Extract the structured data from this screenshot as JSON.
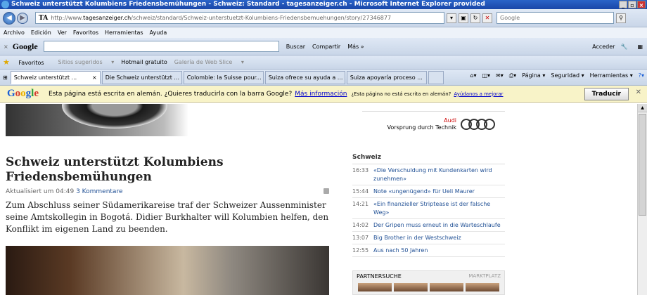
{
  "window": {
    "title": "Schweiz unterstützt Kolumbiens Friedensbemühungen - Schweiz: Standard - tagesanzeiger.ch - Microsoft Internet Explorer provided"
  },
  "address_bar": {
    "url_prefix": "http://www.",
    "url_domain": "tagesanzeiger.ch",
    "url_path": "/schweiz/standard/Schweiz-unterstuetzt-Kolumbiens-Friedensbemuehungen/story/27346877",
    "search_placeholder": "Google"
  },
  "menu": [
    "Archivo",
    "Edición",
    "Ver",
    "Favoritos",
    "Herramientas",
    "Ayuda"
  ],
  "google_toolbar": {
    "logo": "Google",
    "buscar": "Buscar",
    "compartir": "Compartir",
    "mas": "Más »",
    "acceder": "Acceder"
  },
  "favorites_bar": {
    "favoritos": "Favoritos",
    "sitios": "Sitios sugeridos",
    "hotmail": "Hotmail gratuito",
    "galeria": "Galería de Web Slice"
  },
  "tabs": [
    {
      "label": "Schweiz unterstützt ..."
    },
    {
      "label": "Die Schweiz unterstützt ..."
    },
    {
      "label": "Colombie: la Suisse pour..."
    },
    {
      "label": "Suiza ofrece su ayuda a ..."
    },
    {
      "label": "Suiza apoyaría proceso ..."
    }
  ],
  "tab_tools": {
    "pagina": "Página",
    "seguridad": "Seguridad",
    "herramientas": "Herramientas"
  },
  "translate_bar": {
    "logo": "Google",
    "message": "Esta página está escrita en alemán. ¿Quieres traducirla con la barra Google?",
    "more_info": "Más información",
    "not_german": "¿Esta página no está escrita en alemán?",
    "help": "Ayúdanos a mejorar",
    "translate_button": "Traducir"
  },
  "ad": {
    "brand": "Audi",
    "slogan": "Vorsprung durch Technik"
  },
  "article": {
    "headline": "Schweiz unterstützt Kolumbiens Friedensbemühungen",
    "updated": "Aktualisiert um 04:49",
    "comments": "3 Kommentare",
    "lead": "Zum Abschluss seiner Südamerikareise traf der Schweizer Aussenminister seine Amtskollegin in Bogotá. Didier Burkhalter will Kolumbien helfen, den Konflikt im eigenen Land zu beenden."
  },
  "sidebar": {
    "title": "Schweiz",
    "items": [
      {
        "time": "16:33",
        "headline": "«Die Verschuldung mit Kundenkarten wird zunehmen»"
      },
      {
        "time": "15:44",
        "headline": "Note «ungenügend» für Ueli Maurer"
      },
      {
        "time": "14:21",
        "headline": "«Ein finanzieller Striptease ist der falsche Weg»"
      },
      {
        "time": "14:02",
        "headline": "Der Gripen muss erneut in die Warteschlaufe"
      },
      {
        "time": "13:07",
        "headline": "Big Brother in der Westschweiz"
      },
      {
        "time": "12:55",
        "headline": "Aus nach 50 Jahren"
      }
    ]
  },
  "partner": {
    "title": "PARTNERSUCHE",
    "marktplatz": "MARKTPLATZ"
  }
}
